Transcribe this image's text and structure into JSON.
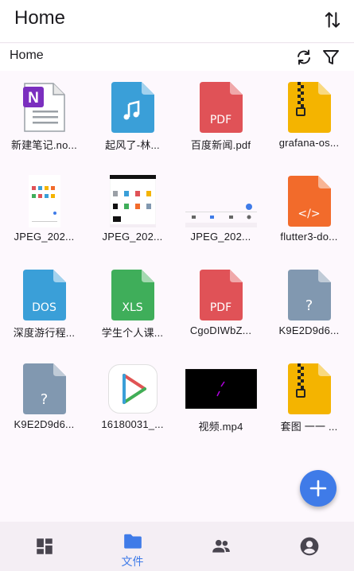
{
  "appbar": {
    "title": "Home",
    "sort_icon": "sort-icon"
  },
  "path": {
    "crumb": "Home",
    "refresh_icon": "refresh-icon",
    "filter_icon": "filter-icon"
  },
  "files": [
    {
      "label": "新建笔记.no...",
      "icon": "onenote-icon"
    },
    {
      "label": "起风了-林...",
      "icon": "music-icon"
    },
    {
      "label": "百度新闻.pdf",
      "icon": "pdf-icon",
      "tag": "PDF"
    },
    {
      "label": "grafana-os...",
      "icon": "zip-icon"
    },
    {
      "label": "JPEG_202...",
      "icon": "screenshot-thumbnail"
    },
    {
      "label": "JPEG_202...",
      "icon": "screenshot-thumbnail"
    },
    {
      "label": "JPEG_202...",
      "icon": "screenshot-thumbnail"
    },
    {
      "label": "flutter3-do...",
      "icon": "code-icon",
      "tag": "</>"
    },
    {
      "label": "深度游行程...",
      "icon": "doc-icon",
      "tag": "DOS"
    },
    {
      "label": "学生个人课...",
      "icon": "xls-icon",
      "tag": "XLS"
    },
    {
      "label": "CgoDIWbZ...",
      "icon": "pdf-icon",
      "tag": "PDF"
    },
    {
      "label": "K9E2D9d6...",
      "icon": "unknown-file-icon",
      "tag": "?"
    },
    {
      "label": "K9E2D9d6...",
      "icon": "unknown-file-icon",
      "tag": "?"
    },
    {
      "label": "16180031_...",
      "icon": "video-player-app-icon"
    },
    {
      "label": "视频.mp4",
      "icon": "video-thumbnail"
    },
    {
      "label": "套图 一一 ...",
      "icon": "zip-icon"
    }
  ],
  "fab": {
    "icon": "add-icon"
  },
  "nav": [
    {
      "icon": "dashboard-icon",
      "label": ""
    },
    {
      "icon": "folder-icon",
      "label": "文件"
    },
    {
      "icon": "people-icon",
      "label": ""
    },
    {
      "icon": "account-icon",
      "label": ""
    }
  ],
  "colors": {
    "accent": "#3f7be8",
    "pdf": "#e05257",
    "music": "#3a9fd8",
    "zip": "#f4b400",
    "code": "#f26b2b",
    "doc": "#3a9fd8",
    "xls": "#3fae5a",
    "unknown": "#8198b0",
    "background": "#fdf8fd"
  }
}
